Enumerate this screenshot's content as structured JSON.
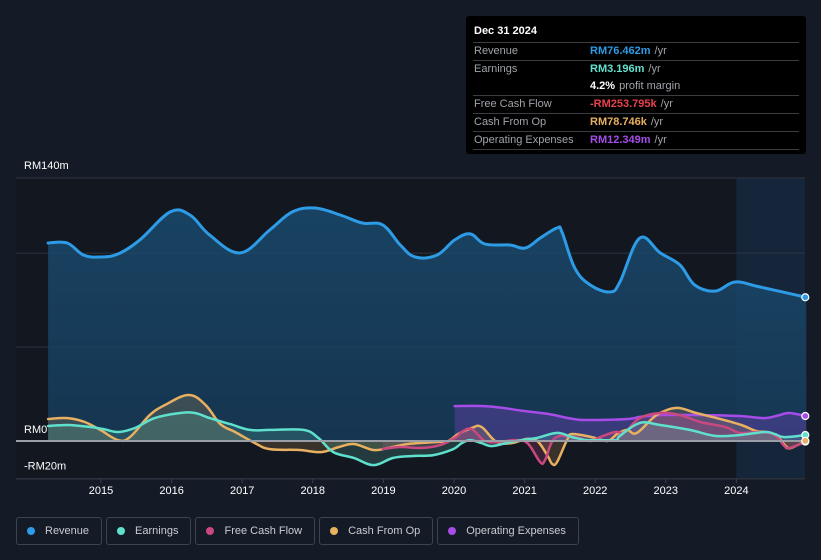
{
  "tooltip": {
    "date": "Dec 31 2024",
    "rows": [
      {
        "label": "Revenue",
        "value": "RM76.462m",
        "unit": "/yr",
        "color": "#2d9be5"
      },
      {
        "label": "Earnings",
        "value": "RM3.196m",
        "unit": "/yr",
        "color": "#63e0cc"
      },
      {
        "label": "",
        "value": "4.2%",
        "unit": "profit margin",
        "color": "#ffffff"
      },
      {
        "label": "Free Cash Flow",
        "value": "-RM253.795k",
        "unit": "/yr",
        "color": "#e8424b"
      },
      {
        "label": "Cash From Op",
        "value": "RM78.746k",
        "unit": "/yr",
        "color": "#e8b061"
      },
      {
        "label": "Operating Expenses",
        "value": "RM12.349m",
        "unit": "/yr",
        "color": "#a64ce8"
      }
    ]
  },
  "legend": [
    {
      "label": "Revenue",
      "color": "#2d9be5"
    },
    {
      "label": "Earnings",
      "color": "#5fe0cc"
    },
    {
      "label": "Free Cash Flow",
      "color": "#c9487f"
    },
    {
      "label": "Cash From Op",
      "color": "#e8b061"
    },
    {
      "label": "Operating Expenses",
      "color": "#a64ce8"
    }
  ],
  "chart_data": {
    "type": "area",
    "title": "",
    "xlabel": "",
    "ylabel": "",
    "unit": "RM millions",
    "xlim": [
      2014.25,
      2024.99
    ],
    "ylim": [
      -20,
      140
    ],
    "y_tick_labels": [
      {
        "value": 140,
        "label": "RM140m"
      },
      {
        "value": 0,
        "label": "RM0"
      },
      {
        "value": -20,
        "label": "-RM20m"
      }
    ],
    "y_gridlines": [
      140,
      100,
      50,
      0,
      -20
    ],
    "x_tick_labels": [
      "2015",
      "2016",
      "2017",
      "2018",
      "2019",
      "2020",
      "2021",
      "2022",
      "2023",
      "2024"
    ],
    "x_ticks": [
      2015,
      2016,
      2017,
      2018,
      2019,
      2020,
      2021,
      2022,
      2023,
      2024
    ],
    "highlight_region": [
      2024.0,
      2024.99
    ],
    "legend_position": "bottom",
    "series": [
      {
        "name": "Revenue",
        "color": "#2d9be5",
        "points": [
          [
            2014.25,
            105.4
          ],
          [
            2014.52,
            105.4
          ],
          [
            2014.75,
            99.0
          ],
          [
            2014.99,
            97.9
          ],
          [
            2015.24,
            99.5
          ],
          [
            2015.55,
            107.0
          ],
          [
            2015.98,
            121.9
          ],
          [
            2016.26,
            120.3
          ],
          [
            2016.54,
            109.6
          ],
          [
            2016.97,
            100.1
          ],
          [
            2017.39,
            112.3
          ],
          [
            2017.71,
            121.9
          ],
          [
            2018.03,
            124.0
          ],
          [
            2018.39,
            120.3
          ],
          [
            2018.7,
            116.0
          ],
          [
            2018.99,
            115.0
          ],
          [
            2019.24,
            104.3
          ],
          [
            2019.45,
            97.9
          ],
          [
            2019.76,
            99.0
          ],
          [
            2020.01,
            107.0
          ],
          [
            2020.23,
            110.2
          ],
          [
            2020.44,
            104.8
          ],
          [
            2020.79,
            104.3
          ],
          [
            2021.01,
            102.7
          ],
          [
            2021.22,
            108.0
          ],
          [
            2021.46,
            113.4
          ],
          [
            2021.53,
            111.2
          ],
          [
            2021.71,
            92.1
          ],
          [
            2021.93,
            83.0
          ],
          [
            2022.21,
            79.3
          ],
          [
            2022.35,
            84.6
          ],
          [
            2022.63,
            108.0
          ],
          [
            2022.92,
            100.1
          ],
          [
            2023.2,
            93.7
          ],
          [
            2023.41,
            83.0
          ],
          [
            2023.7,
            79.8
          ],
          [
            2023.98,
            84.6
          ],
          [
            2024.33,
            82.0
          ],
          [
            2024.99,
            76.5
          ]
        ]
      },
      {
        "name": "Earnings",
        "color": "#5fe0cc",
        "points": [
          [
            2014.25,
            8.0
          ],
          [
            2014.53,
            8.5
          ],
          [
            2014.84,
            7.5
          ],
          [
            2015.03,
            6.4
          ],
          [
            2015.24,
            4.8
          ],
          [
            2015.48,
            6.9
          ],
          [
            2015.76,
            12.2
          ],
          [
            2016.12,
            14.9
          ],
          [
            2016.33,
            14.9
          ],
          [
            2016.54,
            12.2
          ],
          [
            2016.83,
            9.0
          ],
          [
            2017.11,
            5.9
          ],
          [
            2017.39,
            5.9
          ],
          [
            2017.87,
            5.9
          ],
          [
            2018.08,
            1.6
          ],
          [
            2018.29,
            -5.9
          ],
          [
            2018.58,
            -9.0
          ],
          [
            2018.86,
            -12.8
          ],
          [
            2019.14,
            -9.0
          ],
          [
            2019.43,
            -8.0
          ],
          [
            2019.71,
            -7.5
          ],
          [
            2019.99,
            -4.3
          ],
          [
            2020.11,
            -1.1
          ],
          [
            2020.23,
            0.5
          ],
          [
            2020.39,
            -1.1
          ],
          [
            2020.53,
            -2.7
          ],
          [
            2020.74,
            -1.1
          ],
          [
            2020.96,
            0.5
          ],
          [
            2021.17,
            1.6
          ],
          [
            2021.46,
            4.3
          ],
          [
            2021.67,
            2.1
          ],
          [
            2021.88,
            0.5
          ],
          [
            2022.09,
            0.5
          ],
          [
            2022.3,
            0.5
          ],
          [
            2022.35,
            2.7
          ],
          [
            2022.63,
            9.6
          ],
          [
            2022.92,
            8.5
          ],
          [
            2023.34,
            5.9
          ],
          [
            2023.7,
            2.7
          ],
          [
            2024.05,
            3.2
          ],
          [
            2024.4,
            4.8
          ],
          [
            2024.54,
            3.7
          ],
          [
            2024.68,
            2.1
          ],
          [
            2024.99,
            3.2
          ]
        ]
      },
      {
        "name": "Free Cash Flow",
        "color": "#c9487f",
        "points": [
          [
            2018.99,
            -4.3
          ],
          [
            2019.24,
            -3.2
          ],
          [
            2019.53,
            -3.7
          ],
          [
            2019.81,
            -2.1
          ],
          [
            2020.03,
            2.1
          ],
          [
            2020.11,
            4.8
          ],
          [
            2020.25,
            6.4
          ],
          [
            2020.44,
            0.0
          ],
          [
            2020.65,
            -0.5
          ],
          [
            2020.86,
            0.5
          ],
          [
            2021.04,
            -1.1
          ],
          [
            2021.22,
            -11.2
          ],
          [
            2021.29,
            -10.1
          ],
          [
            2021.43,
            1.6
          ],
          [
            2021.71,
            2.1
          ],
          [
            2021.93,
            0.0
          ],
          [
            2022.07,
            2.1
          ],
          [
            2022.28,
            4.8
          ],
          [
            2022.42,
            4.8
          ],
          [
            2022.63,
            12.2
          ],
          [
            2022.92,
            14.9
          ],
          [
            2023.2,
            13.8
          ],
          [
            2023.49,
            10.1
          ],
          [
            2023.84,
            7.5
          ],
          [
            2024.05,
            4.3
          ],
          [
            2024.33,
            4.8
          ],
          [
            2024.54,
            3.2
          ],
          [
            2024.68,
            -2.7
          ],
          [
            2024.75,
            -3.7
          ],
          [
            2024.99,
            -0.3
          ]
        ]
      },
      {
        "name": "Cash From Op",
        "color": "#e8b061",
        "points": [
          [
            2014.25,
            11.7
          ],
          [
            2014.53,
            12.2
          ],
          [
            2014.77,
            10.1
          ],
          [
            2014.99,
            5.9
          ],
          [
            2015.24,
            0.5
          ],
          [
            2015.41,
            2.1
          ],
          [
            2015.69,
            13.8
          ],
          [
            2015.91,
            19.2
          ],
          [
            2016.24,
            24.5
          ],
          [
            2016.48,
            19.2
          ],
          [
            2016.69,
            9.0
          ],
          [
            2016.9,
            4.8
          ],
          [
            2017.18,
            -1.1
          ],
          [
            2017.39,
            -4.3
          ],
          [
            2017.81,
            -4.8
          ],
          [
            2018.12,
            -5.9
          ],
          [
            2018.37,
            -3.2
          ],
          [
            2018.58,
            -1.6
          ],
          [
            2018.86,
            -4.8
          ],
          [
            2019.07,
            -3.7
          ],
          [
            2019.35,
            -1.6
          ],
          [
            2019.78,
            -0.5
          ],
          [
            2019.92,
            0.0
          ],
          [
            2020.06,
            3.7
          ],
          [
            2020.25,
            6.9
          ],
          [
            2020.39,
            7.5
          ],
          [
            2020.6,
            -0.5
          ],
          [
            2020.82,
            -1.1
          ],
          [
            2021.03,
            1.1
          ],
          [
            2021.18,
            0.0
          ],
          [
            2021.32,
            -7.5
          ],
          [
            2021.39,
            -12.2
          ],
          [
            2021.46,
            -11.2
          ],
          [
            2021.6,
            0.5
          ],
          [
            2021.67,
            3.7
          ],
          [
            2021.95,
            2.1
          ],
          [
            2022.17,
            0.0
          ],
          [
            2022.31,
            3.7
          ],
          [
            2022.45,
            5.9
          ],
          [
            2022.59,
            4.3
          ],
          [
            2022.87,
            13.8
          ],
          [
            2023.15,
            17.6
          ],
          [
            2023.43,
            14.9
          ],
          [
            2023.72,
            12.2
          ],
          [
            2024.07,
            8.5
          ],
          [
            2024.28,
            5.3
          ],
          [
            2024.42,
            4.8
          ],
          [
            2024.56,
            3.2
          ],
          [
            2024.7,
            -2.7
          ],
          [
            2024.77,
            -3.7
          ],
          [
            2024.99,
            0.1
          ]
        ]
      },
      {
        "name": "Operating Expenses",
        "color": "#a64ce8",
        "points": [
          [
            2020.01,
            18.6
          ],
          [
            2020.41,
            18.6
          ],
          [
            2020.69,
            17.6
          ],
          [
            2020.98,
            16.0
          ],
          [
            2021.33,
            14.4
          ],
          [
            2021.69,
            11.7
          ],
          [
            2021.9,
            11.2
          ],
          [
            2022.46,
            11.7
          ],
          [
            2022.63,
            12.8
          ],
          [
            2022.92,
            13.8
          ],
          [
            2023.48,
            13.8
          ],
          [
            2024.05,
            13.3
          ],
          [
            2024.4,
            12.2
          ],
          [
            2024.61,
            13.8
          ],
          [
            2024.75,
            14.9
          ],
          [
            2024.99,
            13.3
          ]
        ]
      }
    ]
  }
}
